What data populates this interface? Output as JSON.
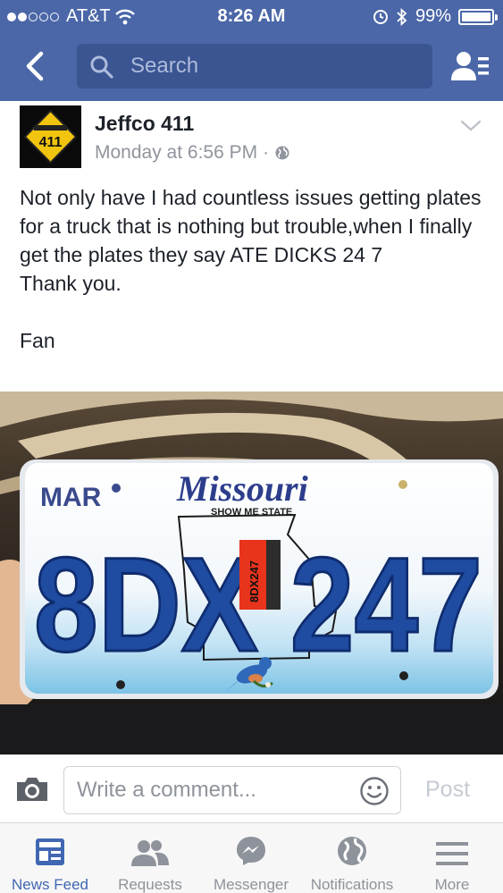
{
  "status_bar": {
    "carrier": "AT&T",
    "time": "8:26 AM",
    "battery": "99%",
    "battery_level": 0.99
  },
  "nav": {
    "search_placeholder": "Search"
  },
  "post": {
    "author": "Jeffco 411",
    "timestamp": "Monday at 6:56 PM",
    "separator": "·",
    "body": [
      "Not only have I had countless issues getting plates for a truck that is nothing but trouble,when I finally get the plates they say ATE DICKS 24 7",
      "Thank you.",
      "",
      "Fan"
    ],
    "avatar_text": "411",
    "photo": {
      "plate_month": "MAR",
      "plate_state": "Missouri",
      "plate_slogan": "SHOW ME STATE",
      "plate_number": "8DX 247",
      "sticker_text": "8DX247"
    }
  },
  "comment": {
    "placeholder": "Write a comment...",
    "post_label": "Post"
  },
  "tabs": [
    {
      "label": "News Feed",
      "icon": "news-feed-icon",
      "active": true
    },
    {
      "label": "Requests",
      "icon": "friend-requests-icon",
      "active": false
    },
    {
      "label": "Messenger",
      "icon": "messenger-icon",
      "active": false
    },
    {
      "label": "Notifications",
      "icon": "globe-icon",
      "active": false
    },
    {
      "label": "More",
      "icon": "menu-icon",
      "active": false
    }
  ],
  "colors": {
    "brand": "#4b67a8",
    "active_tab": "#4267b2",
    "inactive": "#8e939b"
  }
}
